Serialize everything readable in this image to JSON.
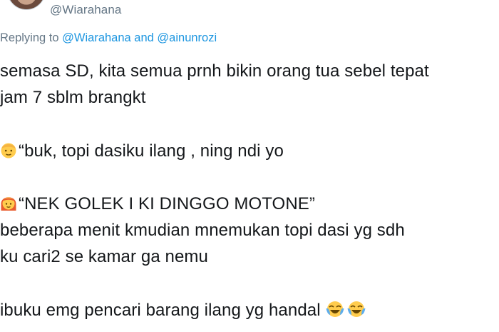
{
  "author": {
    "handle": "@Wiarahana"
  },
  "reply_context": {
    "prefix": "Replying to",
    "mention_1": "@Wiarahana",
    "joiner": "and",
    "mention_2": "@ainunrozi"
  },
  "tweet": {
    "lines": [
      "semasa SD, kita semua prnh bikin orang tua sebel tepat",
      "jam 7 sblm brangkt",
      "“buk, topi dasiku ilang , ning ndi yo",
      "“NEK GOLEK I KI DINGGO MOTONE”",
      " beberapa menit kmudian mnemukan topi dasi yg sdh",
      "ku cari2 se kamar ga nemu",
      "ibuku emg pencari barang ilang yg handal"
    ]
  },
  "icons": {
    "child": "boy-face-emoji",
    "mother": "woman-red-hair-emoji",
    "laugh": "face-with-tears-of-joy-emoji"
  },
  "colors": {
    "text": "#14171a",
    "muted": "#657786",
    "link": "#1b95e0"
  }
}
